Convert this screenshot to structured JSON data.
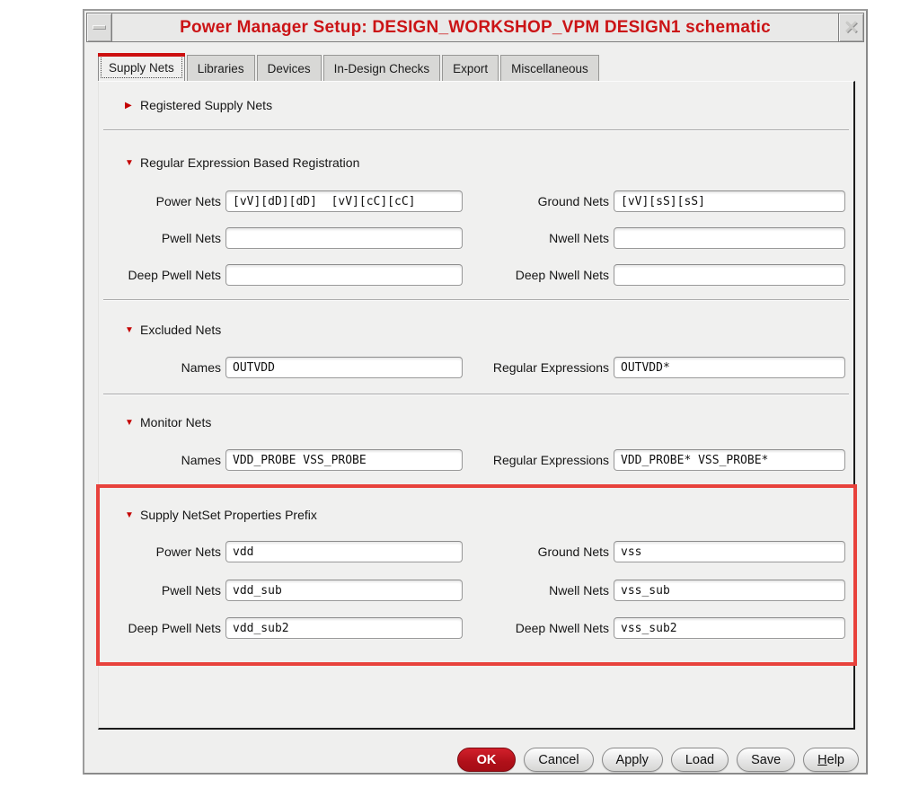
{
  "window": {
    "title": "Power Manager Setup: DESIGN_WORKSHOP_VPM DESIGN1 schematic",
    "close_glyph": "✕",
    "icons": {
      "minimize": "dash-icon",
      "close": "x-icon"
    }
  },
  "colors": {
    "title_red": "#cb1416",
    "tab_accent_red": "#cc0f0f",
    "highlight_box_red": "#e8423c",
    "ok_button_red": "#b01019",
    "dialog_bg": "#efefee"
  },
  "tabs": [
    {
      "label": "Supply Nets",
      "active": true
    },
    {
      "label": "Libraries",
      "active": false
    },
    {
      "label": "Devices",
      "active": false
    },
    {
      "label": "In-Design Checks",
      "active": false
    },
    {
      "label": "Export",
      "active": false
    },
    {
      "label": "Miscellaneous",
      "active": false
    }
  ],
  "glyphs": {
    "collapsed": "▶",
    "expanded": "▼"
  },
  "sections": {
    "registered": {
      "title": "Registered Supply Nets",
      "collapsed": true
    },
    "regex": {
      "title": "Regular Expression Based Registration",
      "power": {
        "label": "Power Nets",
        "value": "[vV][dD][dD]  [vV][cC][cC]"
      },
      "ground": {
        "label": "Ground Nets",
        "value": "[vV][sS][sS]"
      },
      "pwell": {
        "label": "Pwell Nets",
        "value": ""
      },
      "nwell": {
        "label": "Nwell Nets",
        "value": ""
      },
      "deep_pwell": {
        "label": "Deep Pwell Nets",
        "value": ""
      },
      "deep_nwell": {
        "label": "Deep Nwell Nets",
        "value": ""
      }
    },
    "excluded": {
      "title": "Excluded Nets",
      "names": {
        "label": "Names",
        "value": "OUTVDD"
      },
      "regex": {
        "label": "Regular Expressions",
        "value": "OUTVDD*"
      }
    },
    "monitor": {
      "title": "Monitor Nets",
      "names": {
        "label": "Names",
        "value": "VDD_PROBE VSS_PROBE"
      },
      "regex": {
        "label": "Regular Expressions",
        "value": "VDD_PROBE* VSS_PROBE*"
      }
    },
    "netset": {
      "title": "Supply NetSet Properties Prefix",
      "highlighted": true,
      "power": {
        "label": "Power Nets",
        "value": "vdd"
      },
      "ground": {
        "label": "Ground Nets",
        "value": "vss"
      },
      "pwell": {
        "label": "Pwell Nets",
        "value": "vdd_sub"
      },
      "nwell": {
        "label": "Nwell Nets",
        "value": "vss_sub"
      },
      "deep_pwell": {
        "label": "Deep Pwell Nets",
        "value": "vdd_sub2"
      },
      "deep_nwell": {
        "label": "Deep Nwell Nets",
        "value": "vss_sub2"
      }
    }
  },
  "action_buttons": [
    {
      "label": "OK"
    },
    {
      "label": "Cancel"
    },
    {
      "label": "Apply"
    },
    {
      "label": "Load"
    },
    {
      "label": "Save"
    },
    {
      "label": "Help"
    }
  ]
}
